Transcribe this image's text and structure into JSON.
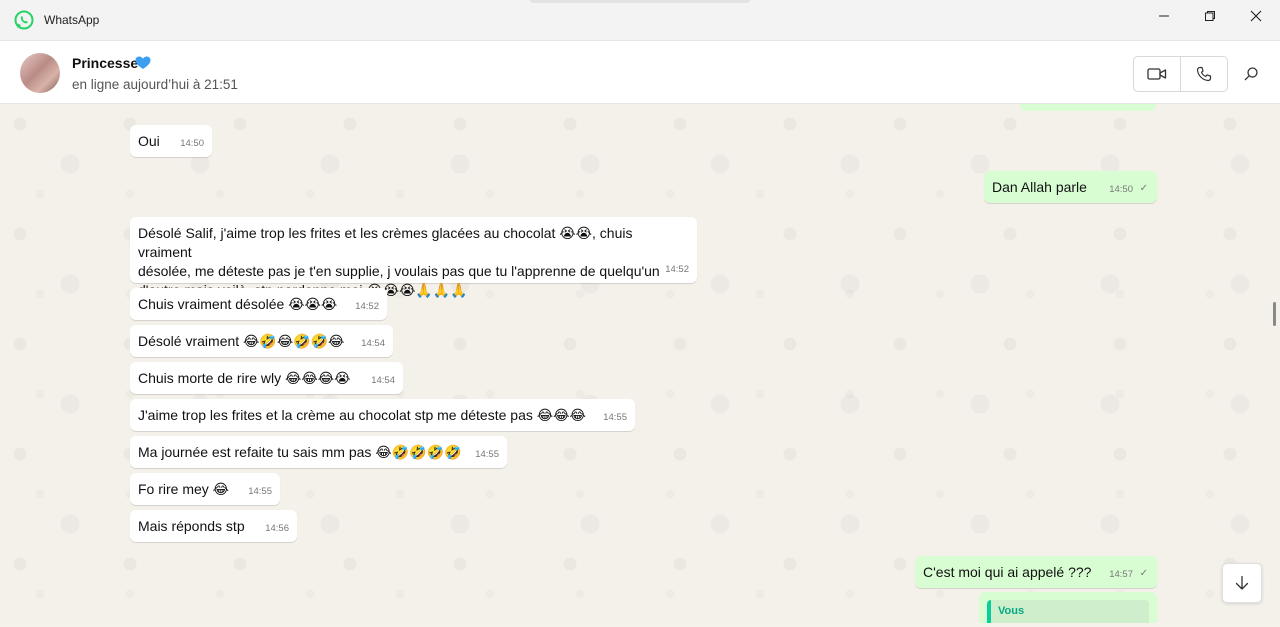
{
  "app": {
    "title": "WhatsApp"
  },
  "window_controls": {
    "minimize": "minimize-icon",
    "maximize": "maximize-icon",
    "close": "close-icon"
  },
  "contact": {
    "name": "Princesse",
    "heart_icon": "blue-heart-icon",
    "status": "en ligne aujourd’hui à 21:51"
  },
  "header_actions": {
    "video": "video-call-icon",
    "voice": "voice-call-icon",
    "search": "search-icon"
  },
  "colors": {
    "incoming": "#ffffff",
    "outgoing": "#d9fdd3",
    "accent": "#06cf9c",
    "brand": "#25d366"
  },
  "messages": [
    {
      "dir": "in",
      "text": "Oui",
      "time": "14:50"
    },
    {
      "dir": "out",
      "text": "Dan Allah parle",
      "time": "14:50",
      "status": "✓"
    },
    {
      "dir": "in",
      "text_lines": [
        "Désolé Salif, j'aime trop les frites et les crèmes glacées au chocolat 😭😭, chuis vraiment",
        "désolée, me déteste pas je t'en supplie, j voulais pas que tu l'apprenne de quelqu'un",
        "d'autre mais voilà, stp pardonne moi 😭😭😭🙏🙏🙏"
      ],
      "time": "14:52"
    },
    {
      "dir": "in",
      "text": "Chuis vraiment désolée 😭😭😭",
      "time": "14:52"
    },
    {
      "dir": "in",
      "text": "Désolé vraiment 😂🤣😂🤣🤣😂",
      "time": "14:54"
    },
    {
      "dir": "in",
      "text": "Chuis morte de rire wly 😂😂😂😭",
      "time": "14:54"
    },
    {
      "dir": "in",
      "text": "J'aime trop les frites et la crème au chocolat stp me déteste pas 😂😂😂",
      "time": "14:55"
    },
    {
      "dir": "in",
      "text": "Ma journée est refaite tu sais mm pas 😂🤣🤣🤣🤣",
      "time": "14:55"
    },
    {
      "dir": "in",
      "text": "Fo rire mey 😂",
      "time": "14:55"
    },
    {
      "dir": "in",
      "text": "Mais réponds stp",
      "time": "14:56"
    },
    {
      "dir": "out",
      "text": "C'est moi qui ai appelé ???",
      "time": "14:57",
      "status": "✓"
    }
  ],
  "quoted_reply": {
    "author": "Vous"
  },
  "scroll_down_icon": "arrow-down-icon"
}
